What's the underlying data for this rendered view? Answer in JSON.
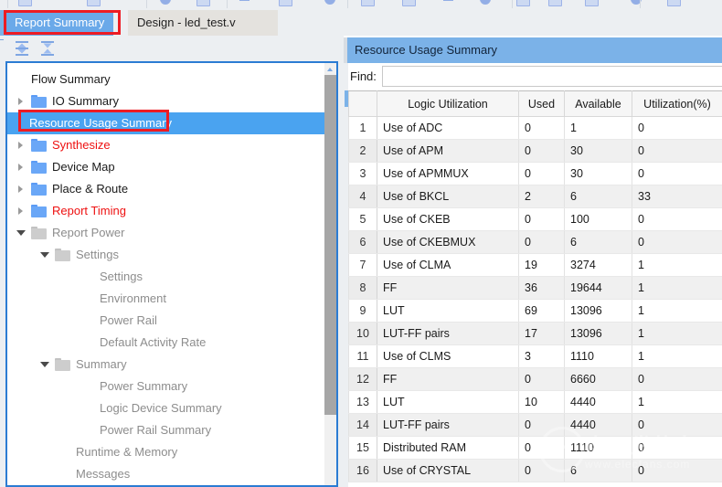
{
  "window": {
    "toolbar_strip_note": "clipped toolbar icons"
  },
  "tabs": {
    "active": "Report Summary",
    "inactive": "Design - led_test.v",
    "close_glyph": "✕"
  },
  "left_pane": {
    "toolbar": {
      "expand_all": "expand-all-icon",
      "collapse_all": "collapse-all-icon"
    },
    "tree": [
      {
        "label": "Flow Summary",
        "indent": 0,
        "arrow": "none",
        "folder": "none",
        "color": "black",
        "selected": false
      },
      {
        "label": "IO Summary",
        "indent": 0,
        "arrow": "collapsed",
        "folder": "blue",
        "color": "black",
        "selected": false
      },
      {
        "label": "Resource Usage Summary",
        "indent": 0,
        "arrow": "none",
        "folder": "none",
        "color": "white",
        "selected": true
      },
      {
        "label": "Synthesize",
        "indent": 0,
        "arrow": "collapsed",
        "folder": "blue",
        "color": "red",
        "selected": false
      },
      {
        "label": "Device Map",
        "indent": 0,
        "arrow": "collapsed",
        "folder": "blue",
        "color": "black",
        "selected": false
      },
      {
        "label": "Place & Route",
        "indent": 0,
        "arrow": "collapsed",
        "folder": "blue",
        "color": "black",
        "selected": false
      },
      {
        "label": "Report Timing",
        "indent": 0,
        "arrow": "collapsed",
        "folder": "blue",
        "color": "red",
        "selected": false
      },
      {
        "label": "Report Power",
        "indent": 0,
        "arrow": "expanded",
        "folder": "gray",
        "color": "gray",
        "selected": false
      },
      {
        "label": "Settings",
        "indent": 1,
        "arrow": "expanded",
        "folder": "gray",
        "color": "gray",
        "selected": false
      },
      {
        "label": "Settings",
        "indent": 2,
        "arrow": "none",
        "folder": "none",
        "color": "gray",
        "selected": false
      },
      {
        "label": "Environment",
        "indent": 2,
        "arrow": "none",
        "folder": "none",
        "color": "gray",
        "selected": false
      },
      {
        "label": "Power Rail",
        "indent": 2,
        "arrow": "none",
        "folder": "none",
        "color": "gray",
        "selected": false
      },
      {
        "label": "Default Activity Rate",
        "indent": 2,
        "arrow": "none",
        "folder": "none",
        "color": "gray",
        "selected": false
      },
      {
        "label": "Summary",
        "indent": 1,
        "arrow": "expanded",
        "folder": "gray",
        "color": "gray",
        "selected": false
      },
      {
        "label": "Power Summary",
        "indent": 2,
        "arrow": "none",
        "folder": "none",
        "color": "gray",
        "selected": false
      },
      {
        "label": "Logic Device Summary",
        "indent": 2,
        "arrow": "none",
        "folder": "none",
        "color": "gray",
        "selected": false
      },
      {
        "label": "Power Rail Summary",
        "indent": 2,
        "arrow": "none",
        "folder": "none",
        "color": "gray",
        "selected": false
      },
      {
        "label": "Runtime & Memory",
        "indent": 1,
        "arrow": "none",
        "folder": "none",
        "color": "gray",
        "selected": false
      },
      {
        "label": "Messages",
        "indent": 1,
        "arrow": "none",
        "folder": "none",
        "color": "gray",
        "selected": false
      }
    ]
  },
  "right_pane": {
    "title": "Resource Usage Summary",
    "find_label": "Find:",
    "find_value": "",
    "find_placeholder": "",
    "table": {
      "columns": [
        "",
        "Logic Utilization",
        "Used",
        "Available",
        "Utilization(%)"
      ],
      "rows": [
        {
          "n": "1",
          "name": "Use of ADC",
          "indent": 0,
          "used": "0",
          "available": "1",
          "util": "0"
        },
        {
          "n": "2",
          "name": "Use of APM",
          "indent": 0,
          "used": "0",
          "available": "30",
          "util": "0"
        },
        {
          "n": "3",
          "name": "Use of APMMUX",
          "indent": 0,
          "used": "0",
          "available": "30",
          "util": "0"
        },
        {
          "n": "4",
          "name": "Use of BKCL",
          "indent": 0,
          "used": "2",
          "available": "6",
          "util": "33"
        },
        {
          "n": "5",
          "name": "Use of CKEB",
          "indent": 0,
          "used": "0",
          "available": "100",
          "util": "0"
        },
        {
          "n": "6",
          "name": "Use of CKEBMUX",
          "indent": 0,
          "used": "0",
          "available": "6",
          "util": "0"
        },
        {
          "n": "7",
          "name": "Use of CLMA",
          "indent": 0,
          "used": "19",
          "available": "3274",
          "util": "1"
        },
        {
          "n": "8",
          "name": "FF",
          "indent": 1,
          "used": "36",
          "available": "19644",
          "util": "1"
        },
        {
          "n": "9",
          "name": "LUT",
          "indent": 1,
          "used": "69",
          "available": "13096",
          "util": "1"
        },
        {
          "n": "10",
          "name": "LUT-FF pairs",
          "indent": 1,
          "used": "17",
          "available": "13096",
          "util": "1"
        },
        {
          "n": "11",
          "name": "Use of CLMS",
          "indent": 0,
          "used": "3",
          "available": "1110",
          "util": "1"
        },
        {
          "n": "12",
          "name": "FF",
          "indent": 1,
          "used": "0",
          "available": "6660",
          "util": "0"
        },
        {
          "n": "13",
          "name": "LUT",
          "indent": 1,
          "used": "10",
          "available": "4440",
          "util": "1"
        },
        {
          "n": "14",
          "name": "LUT-FF pairs",
          "indent": 1,
          "used": "0",
          "available": "4440",
          "util": "0"
        },
        {
          "n": "15",
          "name": "Distributed RAM",
          "indent": 1,
          "used": "0",
          "available": "1110",
          "util": "0"
        },
        {
          "n": "16",
          "name": "Use of CRYSTAL",
          "indent": 0,
          "used": "0",
          "available": "6",
          "util": "0"
        }
      ]
    }
  },
  "watermark": {
    "cn": "电子发烧友",
    "en": "www.elecfans.com"
  },
  "colors": {
    "accent_blue": "#6aa9e9",
    "selection_blue": "#4aa3f0",
    "annotation_red": "#ed1c24",
    "tree_red_text": "#ee1111"
  }
}
